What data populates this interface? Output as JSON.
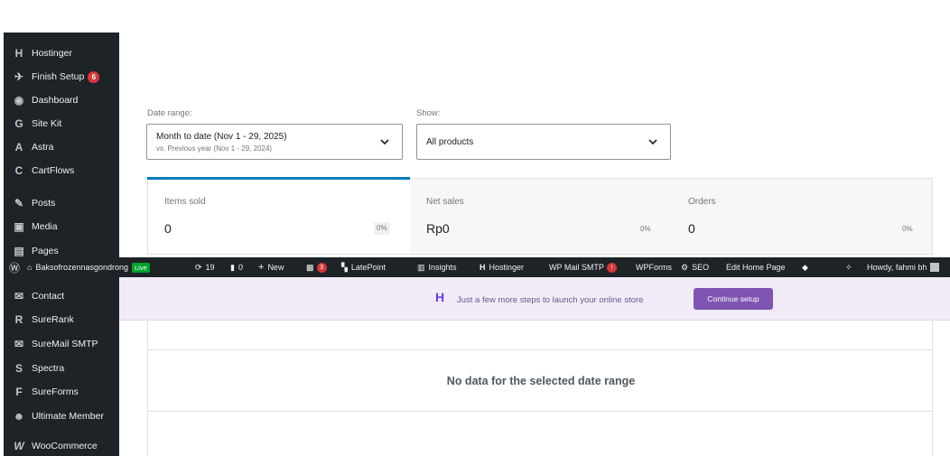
{
  "sidebar": {
    "items": [
      {
        "label": "Hostinger",
        "icon": "hostinger-icon",
        "glyph": "H"
      },
      {
        "label": "Finish Setup",
        "icon": "rocket-icon",
        "glyph": "✈",
        "badge": "6"
      },
      {
        "label": "Dashboard",
        "icon": "dashboard-icon",
        "glyph": "◉"
      },
      {
        "label": "Site Kit",
        "icon": "google-icon",
        "glyph": "G"
      },
      {
        "label": "Astra",
        "icon": "astra-icon",
        "glyph": "A"
      },
      {
        "label": "CartFlows",
        "icon": "cartflows-icon",
        "glyph": "C"
      },
      {
        "label": "Posts",
        "icon": "pin-icon",
        "glyph": "✎"
      },
      {
        "label": "Media",
        "icon": "media-icon",
        "glyph": "▣"
      },
      {
        "label": "Pages",
        "icon": "pages-icon",
        "glyph": "▤"
      },
      {
        "label": "Contact",
        "icon": "mail-icon",
        "glyph": "✉"
      },
      {
        "label": "SureRank",
        "icon": "surerank-icon",
        "glyph": "R"
      },
      {
        "label": "SureMail SMTP",
        "icon": "suremail-icon",
        "glyph": "✉"
      },
      {
        "label": "Spectra",
        "icon": "spectra-icon",
        "glyph": "S"
      },
      {
        "label": "SureForms",
        "icon": "sureforms-icon",
        "glyph": "F"
      },
      {
        "label": "Ultimate Member",
        "icon": "user-icon",
        "glyph": "☻"
      },
      {
        "label": "WooCommerce",
        "icon": "woocommerce-icon",
        "glyph": "W"
      }
    ]
  },
  "filters": {
    "date_range_label": "Date range:",
    "date_range_value": "Month to date (Nov 1 - 29, 2025)",
    "date_range_compare": "vs. Previous year (Nov 1 - 29, 2024)",
    "show_label": "Show:",
    "show_value": "All products"
  },
  "stats": [
    {
      "title": "Items sold",
      "value": "0",
      "pct": "0%"
    },
    {
      "title": "Net sales",
      "value": "Rp0",
      "pct": "0%"
    },
    {
      "title": "Orders",
      "value": "0",
      "pct": "0%"
    }
  ],
  "adminbar": {
    "site_name": "Baksofrozennasgondrong",
    "live": "Live",
    "updates": "19",
    "comments": "0",
    "new": "New",
    "badge_count": "3",
    "latepoint": "LatePoint",
    "insights": "Insights",
    "hostinger": "Hostinger",
    "wp_mail_smtp": "WP Mail SMTP",
    "wp_mail_badge": "!",
    "wpforms": "WPForms",
    "seo": "SEO",
    "edit_home": "Edit Home Page",
    "howdy": "Howdy, fahmi bh"
  },
  "banner": {
    "text": "Just a few more steps to launch your online store",
    "button": "Continue setup"
  },
  "empty_state": "No data for the selected date range",
  "colors": {
    "sidebar_bg": "#1d2327",
    "accent": "#007cba",
    "woo_purple": "#7f54b3",
    "badge_red": "#d63638",
    "live_green": "#00a32a"
  }
}
